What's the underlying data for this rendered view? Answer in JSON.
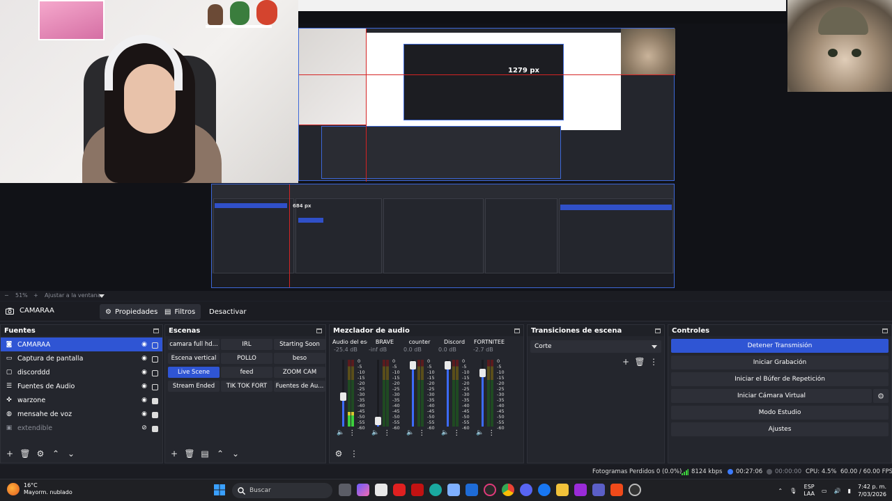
{
  "preview": {
    "nested_label_1": "1279 px",
    "nested_label_2": "684 px",
    "zoom": "51%",
    "fit": "Ajustar a la ventana"
  },
  "context_bar": {
    "source_name": "CAMARAA",
    "properties": "Propiedades",
    "filters": "Filtros",
    "deactivate": "Desactivar"
  },
  "sources": {
    "title": "Fuentes",
    "items": [
      {
        "label": "CAMARAA",
        "icon": "camera-icon",
        "selected": true,
        "visible": true,
        "locked": false
      },
      {
        "label": "Captura de pantalla",
        "icon": "monitor-icon",
        "selected": false,
        "visible": true,
        "locked": false
      },
      {
        "label": "discorddd",
        "icon": "window-icon",
        "selected": false,
        "visible": true,
        "locked": false
      },
      {
        "label": "Fuentes de Audio",
        "icon": "list-icon",
        "selected": false,
        "visible": true,
        "locked": false
      },
      {
        "label": "warzone",
        "icon": "gamepad-icon",
        "selected": false,
        "visible": true,
        "locked": true
      },
      {
        "label": "mensahe de voz",
        "icon": "globe-icon",
        "selected": false,
        "visible": true,
        "locked": true
      },
      {
        "label": "extendible",
        "icon": "image-icon",
        "selected": false,
        "visible": false,
        "locked": true
      }
    ]
  },
  "scenes": {
    "title": "Escenas",
    "items": [
      {
        "label": "camara full hd...",
        "active": false
      },
      {
        "label": "IRL",
        "active": false
      },
      {
        "label": "Starting Soon",
        "active": false
      },
      {
        "label": "Escena vertical",
        "active": false
      },
      {
        "label": "POLLO",
        "active": false
      },
      {
        "label": "beso",
        "active": false
      },
      {
        "label": "Live Scene",
        "active": true
      },
      {
        "label": "feed",
        "active": false
      },
      {
        "label": "ZOOM CAM",
        "active": false
      },
      {
        "label": "Stream Ended",
        "active": false
      },
      {
        "label": "TIK TOK FORT",
        "active": false
      },
      {
        "label": "Fuentes de Au...",
        "active": false
      }
    ]
  },
  "mixer": {
    "title": "Mezclador de audio",
    "channels": [
      {
        "name": "Audio del escritorio",
        "db": "-25.4 dB",
        "fader": 0.45,
        "level": 0.22
      },
      {
        "name": "BRAVE",
        "db": "-inf dB",
        "fader": 0.08,
        "level": 0.0
      },
      {
        "name": "counter",
        "db": "0.0 dB",
        "fader": 0.92,
        "level": 0.0
      },
      {
        "name": "Discord",
        "db": "0.0 dB",
        "fader": 0.92,
        "level": 0.0
      },
      {
        "name": "FORTNITEE",
        "db": "-2.7 dB",
        "fader": 0.8,
        "level": 0.0
      }
    ],
    "scale": [
      "0",
      "-5",
      "-10",
      "-15",
      "-20",
      "-25",
      "-30",
      "-35",
      "-40",
      "-45",
      "-50",
      "-55",
      "-60"
    ]
  },
  "transitions": {
    "title": "Transiciones de escena",
    "selected": "Corte"
  },
  "controls": {
    "title": "Controles",
    "stop_stream": "Detener Transmisión",
    "start_record": "Iniciar Grabación",
    "replay_buffer": "Iniciar el Búfer de Repetición",
    "virtual_cam": "Iniciar Cámara Virtual",
    "studio_mode": "Modo Estudio",
    "settings": "Ajustes"
  },
  "status": {
    "dropped": "Fotogramas Perdidos 0 (0.0%)",
    "bitrate": "8124 kbps",
    "stream_time": "00:27:06",
    "record_time": "00:00:00",
    "cpu": "CPU: 4.5%",
    "fps": "60.00 / 60.00 FPS"
  },
  "taskbar": {
    "temp": "16°C",
    "weather": "Mayorm. nublado",
    "search": "Buscar",
    "lang1": "ESP",
    "lang2": "LAA",
    "time": "7:42 p. m.",
    "date": "7/03/2026"
  },
  "colors": {
    "accent": "#2f55d4",
    "panel": "#24262d",
    "background": "#1d1f26"
  }
}
